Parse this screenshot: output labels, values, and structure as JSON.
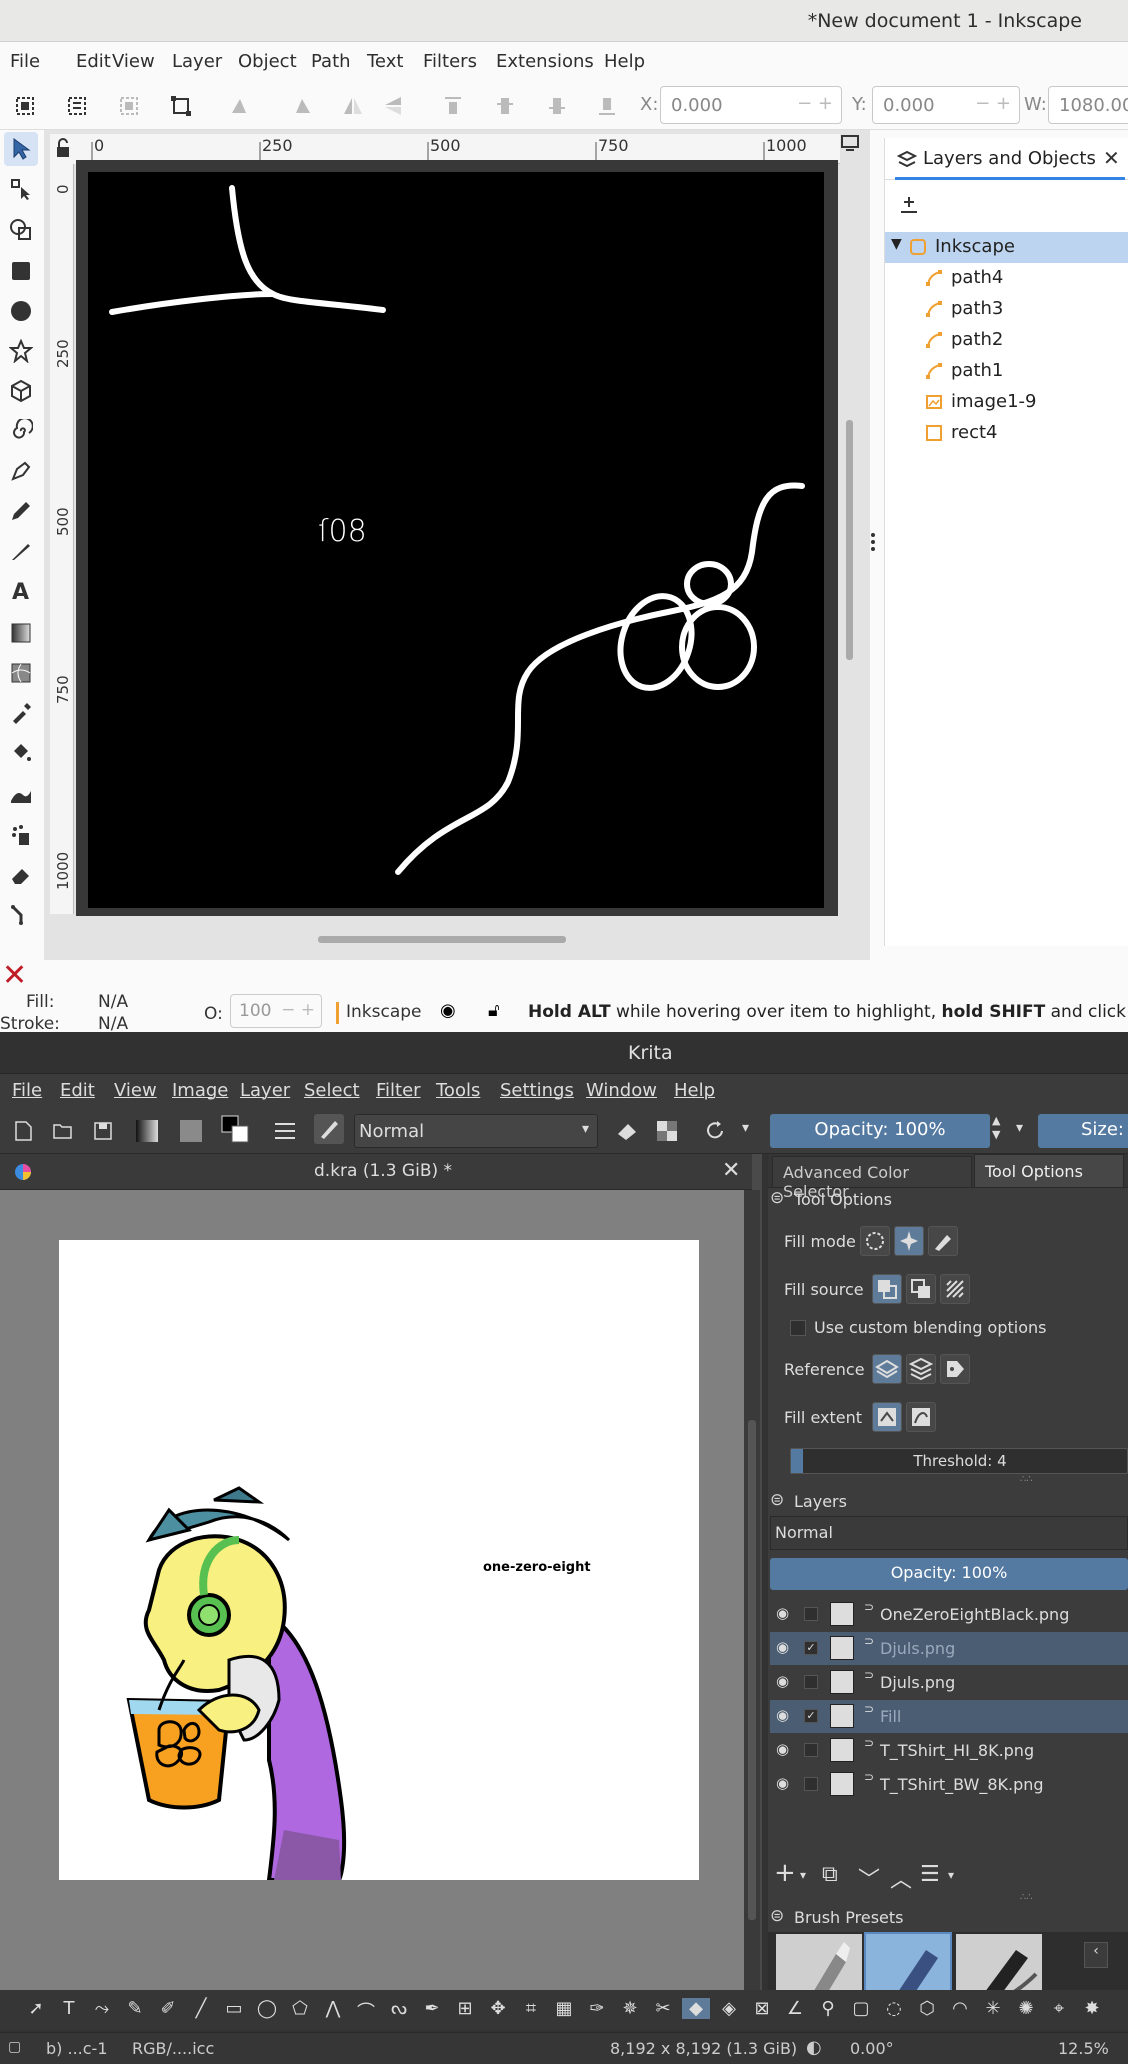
{
  "inkscape": {
    "title": "*New document 1 - Inkscape",
    "menu": [
      "File",
      "Edit",
      "View",
      "Layer",
      "Object",
      "Path",
      "Text",
      "Filters",
      "Extensions",
      "Help"
    ],
    "coords": {
      "x_label": "X:",
      "x": "0.000",
      "y_label": "Y:",
      "y": "0.000",
      "w_label": "W:",
      "w": "1080.00"
    },
    "ruler_h": [
      "0",
      "250",
      "500",
      "750",
      "1000"
    ],
    "ruler_v": [
      "0",
      "250",
      "500",
      "750",
      "1000"
    ],
    "canvas_small_text": "ſ08",
    "panel": {
      "tab_label": "Layers and Objects",
      "root": "Inkscape",
      "items": [
        "path4",
        "path3",
        "path2",
        "path1",
        "image1-9",
        "rect4"
      ]
    },
    "status": {
      "fill_label": "Fill:",
      "fill_value": "N/A",
      "stroke_label": "Stroke:",
      "stroke_value": "N/A",
      "opacity_label": "O:",
      "opacity_value": "100",
      "layer": "Inkscape",
      "hint_b1": "Hold ALT",
      "hint_t1": " while hovering over item to highlight, ",
      "hint_b2": "hold SHIFT",
      "hint_t2": " and click to hic"
    }
  },
  "krita": {
    "title": "Krita",
    "menu": [
      "File",
      "Edit",
      "View",
      "Image",
      "Layer",
      "Select",
      "Filter",
      "Tools",
      "Settings",
      "Window",
      "Help"
    ],
    "blend_mode": "Normal",
    "opacity": "Opacity: 100%",
    "size": "Size:",
    "doc_tab": "d.kra (1.3 GiB) *",
    "canvas_text": "one-zero-eight",
    "dock_tabs": [
      "Advanced Color Selector",
      "Tool Options"
    ],
    "tool_options": {
      "header": "Tool Options",
      "fill_mode": "Fill mode",
      "fill_source": "Fill source",
      "custom_blend": "Use custom blending options",
      "reference": "Reference",
      "fill_extent": "Fill extent",
      "threshold": "Threshold: 4"
    },
    "layers": {
      "header": "Layers",
      "blend": "Normal",
      "opacity": "Opacity:  100%",
      "items": [
        {
          "name": "OneZeroEightBlack.png",
          "checked": false,
          "selected": false
        },
        {
          "name": "Djuls.png",
          "checked": true,
          "selected": true
        },
        {
          "name": "Djuls.png",
          "checked": false,
          "selected": false
        },
        {
          "name": "Fill",
          "checked": true,
          "selected": true
        },
        {
          "name": "T_TShirt_HI_8K.png",
          "checked": false,
          "selected": false
        },
        {
          "name": "T_TShirt_BW_8K.png",
          "checked": false,
          "selected": false
        }
      ]
    },
    "brush_presets": "Brush Presets",
    "status": {
      "left": "b) ...c-1",
      "profile": "RGB/....icc",
      "dims": "8,192 x 8,192 (1.3 GiB)",
      "rotation": "0.00°",
      "zoom": "12.5%"
    }
  }
}
